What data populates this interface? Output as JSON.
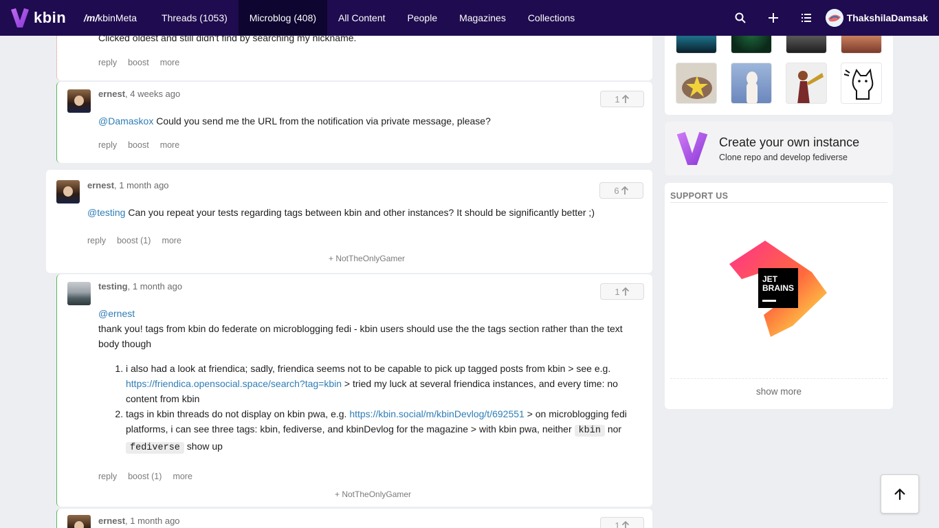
{
  "nav": {
    "logo_text": "kbin",
    "magazine_prefix": "/m/",
    "magazine_name": "kbinMeta",
    "tabs": [
      {
        "label": "Threads (1053)",
        "active": false
      },
      {
        "label": "Microblog (408)",
        "active": true
      },
      {
        "label": "All Content",
        "active": false
      },
      {
        "label": "People",
        "active": false
      },
      {
        "label": "Magazines",
        "active": false
      },
      {
        "label": "Collections",
        "active": false
      }
    ],
    "icons": [
      "search-icon",
      "plus-icon",
      "list-icon"
    ],
    "username": "ThakshilaDamsak"
  },
  "comments": [
    {
      "partial_text": "Clicked oldest and still didn't find by searching my nickname.",
      "actions": [
        "reply",
        "boost",
        "more"
      ]
    },
    {
      "author": "ernest",
      "time": ", 4 weeks ago",
      "votes": "1",
      "mention": "@Damaskox",
      "text": " Could you send me the URL from the notification via private message, please?",
      "actions": [
        "reply",
        "boost",
        "more"
      ]
    },
    {
      "author": "ernest",
      "time": ", 1 month ago",
      "votes": "6",
      "mention": "@testing",
      "text": " Can you repeat your tests regarding tags between kbin and other instances? It should be significantly better ;)",
      "actions": [
        "reply",
        "boost (1)",
        "more"
      ],
      "booster": "+ NotTheOnlyGamer"
    },
    {
      "author": "testing",
      "time": ", 1 month ago",
      "votes": "1",
      "mention": "@ernest",
      "text": "thank you! tags from kbin do federate on microblogging fedi - kbin users should use the the tags section rather than the text body though",
      "list": [
        {
          "before": "i also had a look at friendica; sadly, friendica seems not to be capable to pick up tagged posts from kbin > see e.g. ",
          "link": "https://friendica.opensocial.space/search?tag=kbin",
          "after": " > tried my luck at several friendica instances, and every time: no content from kbin"
        },
        {
          "before": "tags in kbin threads do not display on kbin pwa, e.g. ",
          "link": "https://kbin.social/m/kbinDevlog/t/692551",
          "after": " > on microblogging fedi platforms, i can see three tags: kbin, fediverse, and kbinDevlog for the magazine > with kbin pwa, neither ",
          "code1": "kbin",
          "mid": " nor ",
          "code2": "fediverse",
          "end": " show up"
        }
      ],
      "actions": [
        "reply",
        "boost (1)",
        "more"
      ],
      "booster": "+ NotTheOnlyGamer"
    },
    {
      "author": "ernest",
      "time": ", 1 month ago",
      "votes": "1"
    }
  ],
  "sidebar": {
    "instance_title": "Create your own instance",
    "instance_subtitle": "Clone repo and develop fediverse",
    "support_title": "SUPPORT US",
    "sponsor_logo_text": [
      "JET",
      "BRAINS"
    ],
    "show_more": "show more"
  },
  "colors": {
    "topbar": "#1f0b4f",
    "accent": "#2e7db5",
    "nested_border": "#5bb55b"
  }
}
